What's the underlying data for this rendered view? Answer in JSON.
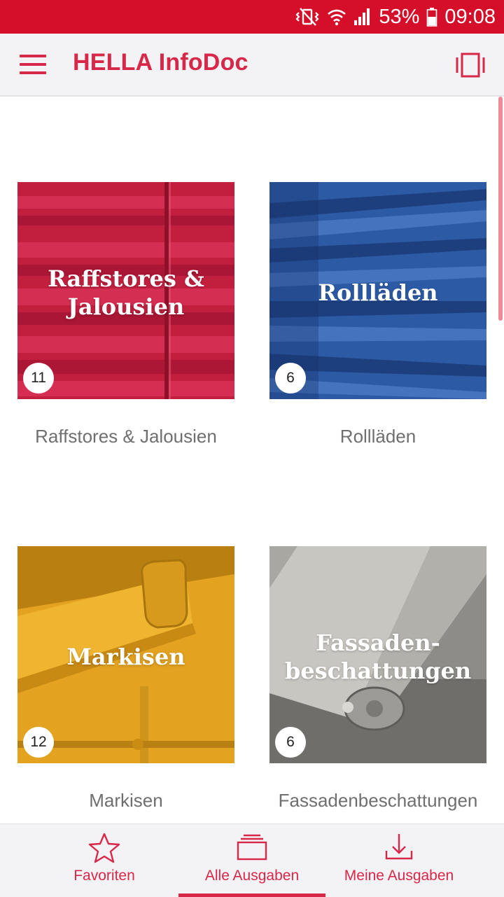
{
  "status_bar": {
    "battery_percent": "53%",
    "time": "09:08",
    "icons": [
      "vibrate-mute-icon",
      "wifi-icon",
      "signal-icon",
      "battery-icon"
    ]
  },
  "app_bar": {
    "title": "HELLA InfoDoc",
    "menu_icon": "hamburger-menu-icon",
    "layout_icon": "view-carousel-icon"
  },
  "colors": {
    "brand": "#d8284a",
    "status_bar": "#d50f29"
  },
  "categories": [
    {
      "tile_title": "Raffstores &\nJalousien",
      "count": "11",
      "label": "Raffstores & Jalousien"
    },
    {
      "tile_title": "Rollläden",
      "count": "6",
      "label": "Rollläden"
    },
    {
      "tile_title": "Markisen",
      "count": "12",
      "label": "Markisen"
    },
    {
      "tile_title": "Fassaden-\nbeschattungen",
      "count": "6",
      "label": "Fassadenbeschattungen"
    }
  ],
  "bottom_nav": {
    "items": [
      {
        "label": "Favoriten",
        "icon": "star-icon",
        "active": false
      },
      {
        "label": "Alle Ausgaben",
        "icon": "stacked-layers-icon",
        "active": true
      },
      {
        "label": "Meine Ausgaben",
        "icon": "download-icon",
        "active": false
      }
    ]
  }
}
